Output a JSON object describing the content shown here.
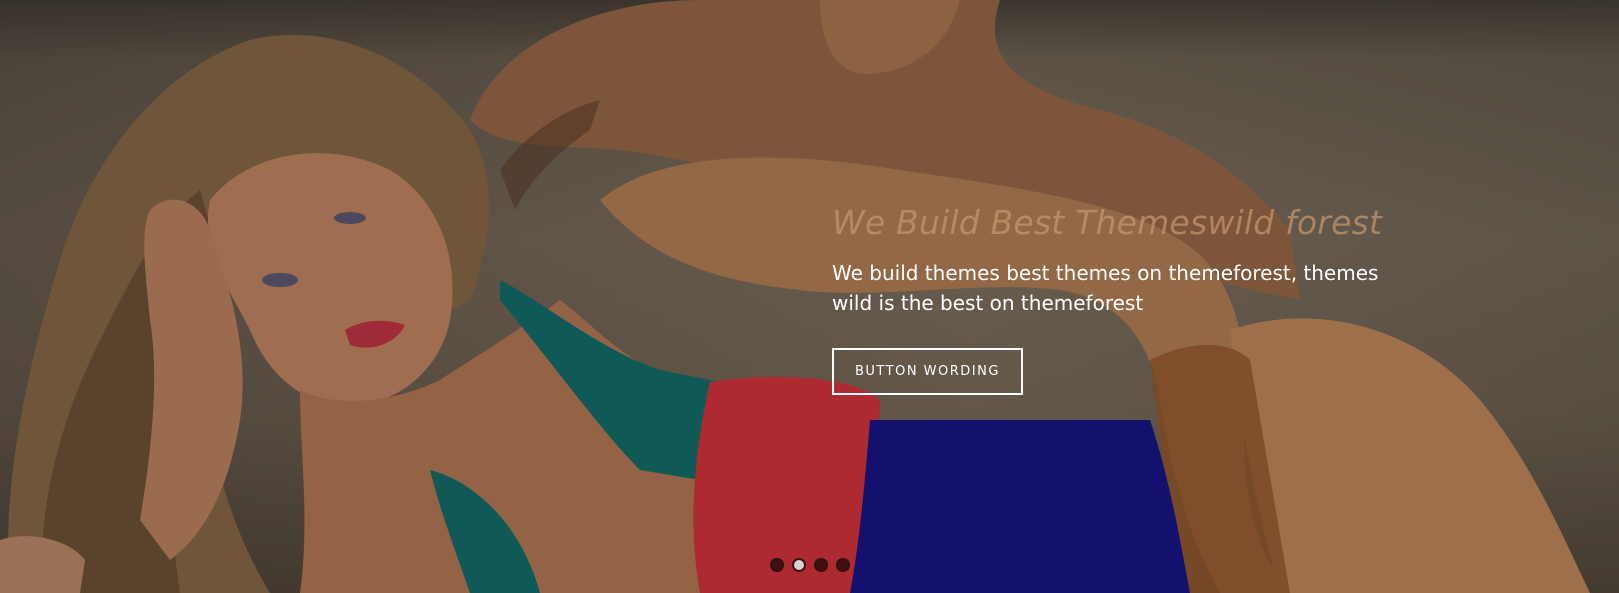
{
  "slider": {
    "title": "We Build Best Themeswild forest",
    "text": "We build themes best themes on themeforest, themes wild is the best on themeforest",
    "button_label": "BUTTON WORDING",
    "dots": [
      {
        "label": "slide 1",
        "active": false
      },
      {
        "label": "slide 2",
        "active": true
      },
      {
        "label": "slide 3",
        "active": false
      },
      {
        "label": "slide 4",
        "active": false
      }
    ]
  },
  "colors": {
    "title": "#c8966e",
    "text": "#ffffff",
    "dot_inactive": "#3b1210",
    "dot_active": "#d6d2ce",
    "swimsuit_teal": "#0f6f6c",
    "swimsuit_red": "#d8323c",
    "swimsuit_blue": "#14128a"
  }
}
